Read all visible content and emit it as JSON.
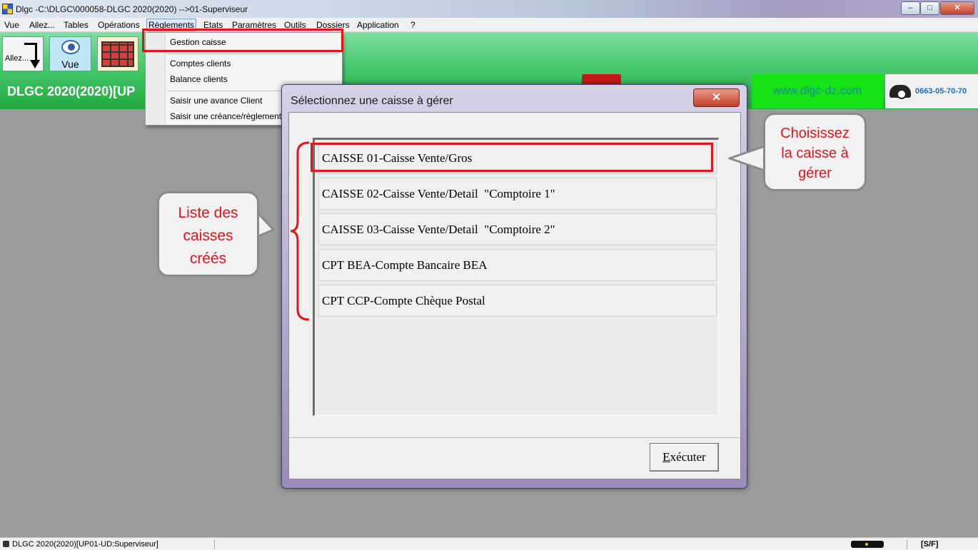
{
  "window": {
    "title": "Dlgc -C:\\DLGC\\000058-DLGC 2020(2020) -->01-Superviseur",
    "minimize": "–",
    "maximize": "□",
    "close": "✕"
  },
  "menubar": {
    "items": [
      "Vue",
      "Allez...",
      "Tables",
      "Opérations",
      "Règlements",
      "Etats",
      "Paramètres",
      "Outils",
      "Dossiers",
      "Application",
      "?"
    ]
  },
  "toolbar": {
    "allez_label": "Allez...",
    "vue_label": "Vue"
  },
  "banner": {
    "title": "DLGC 2020(2020)[UP",
    "website": "www.dlgc-dz.com",
    "phone": "0663-05-70-70"
  },
  "dropdown": {
    "items": [
      "Gestion caisse",
      "Comptes clients",
      "Balance clients",
      "Saisir une avance Client",
      "Saisir une créance/règlement"
    ]
  },
  "dialog": {
    "title": "Sélectionnez une caisse à gérer",
    "close_label": "✕",
    "items": [
      "CAISSE 01-Caisse Vente/Gros",
      "CAISSE 02-Caisse Vente/Detail  \"Comptoire 1\"",
      "CAISSE 03-Caisse Vente/Detail  \"Comptoire 2\"",
      "CPT BEA-Compte Bancaire BEA",
      "CPT CCP-Compte Chèque Postal"
    ],
    "execute_first": "E",
    "execute_rest": "xécuter"
  },
  "callouts": {
    "left": [
      "Liste des",
      "caisses",
      "créés"
    ],
    "right": [
      "Choisissez",
      "la caisse à",
      "gérer"
    ]
  },
  "statusbar": {
    "session": "DLGC 2020(2020)[UP01-UD:Superviseur]",
    "mode": "[S/F]"
  },
  "colors": {
    "highlight": "#e8131a",
    "banner_green": "#22aa3e",
    "url_green": "#14e214"
  }
}
